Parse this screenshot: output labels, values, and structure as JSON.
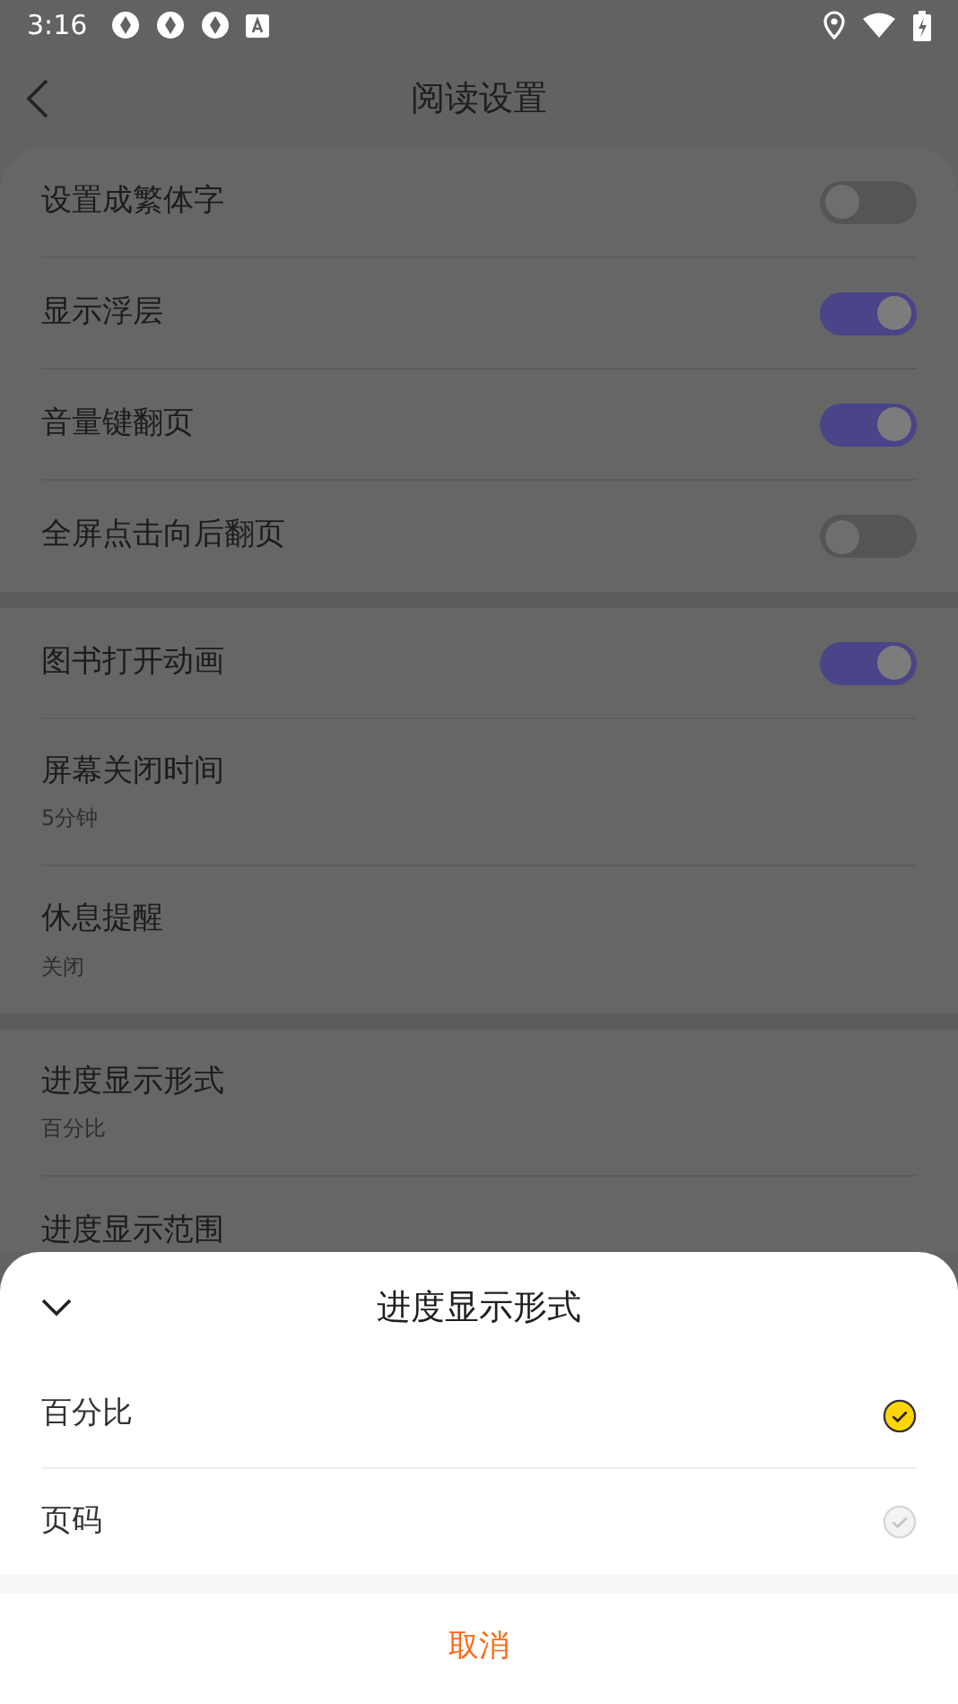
{
  "status_bar": {
    "time": "3:16"
  },
  "header": {
    "title": "阅读设置"
  },
  "groups": [
    {
      "items": [
        {
          "kind": "toggle",
          "label": "设置成繁体字",
          "on": false
        },
        {
          "kind": "toggle",
          "label": "显示浮层",
          "on": true
        },
        {
          "kind": "toggle",
          "label": "音量键翻页",
          "on": true
        },
        {
          "kind": "toggle",
          "label": "全屏点击向后翻页",
          "on": false
        }
      ]
    },
    {
      "items": [
        {
          "kind": "toggle",
          "label": "图书打开动画",
          "on": true
        },
        {
          "kind": "value",
          "label": "屏幕关闭时间",
          "value": "5分钟"
        },
        {
          "kind": "value",
          "label": "休息提醒",
          "value": "关闭"
        }
      ]
    },
    {
      "items": [
        {
          "kind": "value",
          "label": "进度显示形式",
          "value": "百分比"
        },
        {
          "kind": "plain",
          "label": "进度显示范围"
        }
      ]
    }
  ],
  "sheet": {
    "title": "进度显示形式",
    "options": [
      {
        "label": "百分比",
        "selected": true
      },
      {
        "label": "页码",
        "selected": false
      }
    ],
    "cancel": "取消"
  }
}
